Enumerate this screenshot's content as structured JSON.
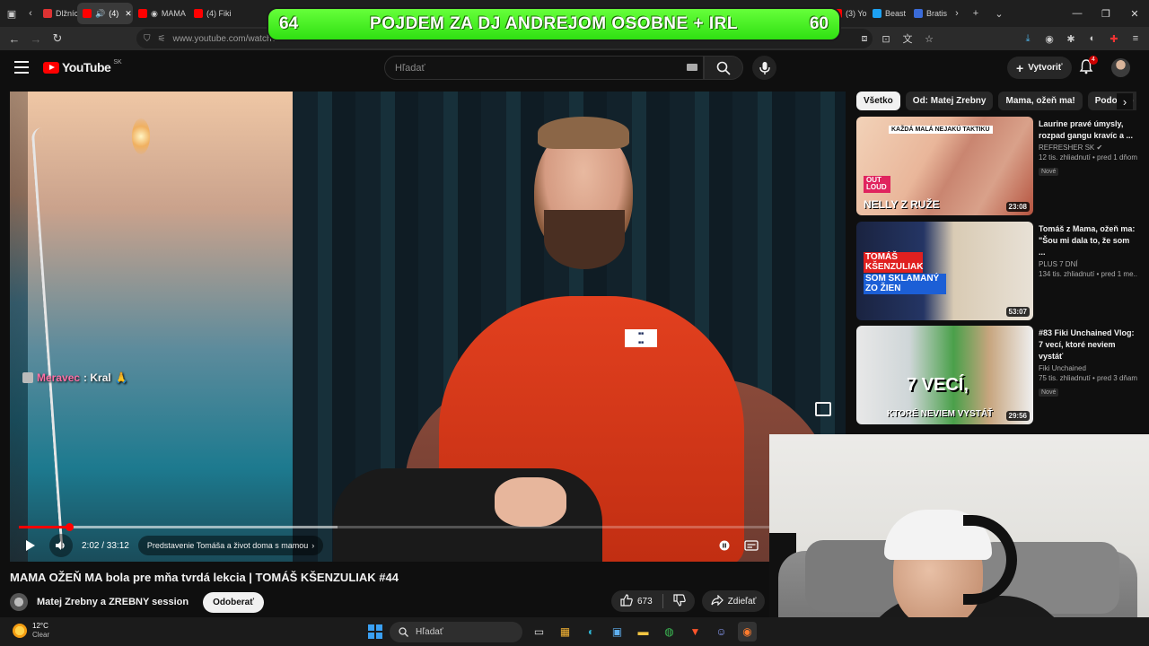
{
  "browser": {
    "tabs": [
      {
        "label": "Dlžníci",
        "active": false,
        "favicon": "doc"
      },
      {
        "label": "(4)",
        "active": true,
        "favicon": "youtube",
        "audio": true
      },
      {
        "label": "MAMA",
        "active": false,
        "favicon": "youtube"
      },
      {
        "label": "(4) Fiki",
        "active": false,
        "favicon": "youtube"
      },
      {
        "label": "(3) Yo",
        "active": false,
        "favicon": "youtube"
      },
      {
        "label": "Beast",
        "active": false,
        "favicon": "other"
      },
      {
        "label": "Bratis",
        "active": false,
        "favicon": "other"
      }
    ],
    "url": "www.youtube.com/watch?"
  },
  "banner": {
    "left_number": "64",
    "text": "POJDEM ZA DJ ANDREJOM OSOBNE + IRL",
    "right_number": "60",
    "color": "#3be81a"
  },
  "masthead": {
    "logo_text": "YouTube",
    "country": "SK",
    "search_placeholder": "Hľadať",
    "create_label": "Vytvoriť",
    "notifications_count": "4"
  },
  "player": {
    "chat_nick": "Meravec",
    "chat_message": ": Kral",
    "time": "2:02 / 33:12",
    "chapter": "Predstavenie Tomáša a život doma s mamou",
    "progress_fraction": 0.061,
    "buffer_fraction": 0.39,
    "accent": "#ff0000"
  },
  "video": {
    "title": "MAMA OŽEŇ MA bola pre mňa tvrdá lekcia | TOMÁŠ KŠENZULIAK #44",
    "channel": "Matej Zrebny a ZREBNY session",
    "subscribe_label": "Odoberať",
    "likes": "673",
    "share_label": "Zdieľať"
  },
  "chips": [
    "Všetko",
    "Od: Matej Zrebny",
    "Mama, ožeň ma!",
    "Podobné"
  ],
  "recommendations": [
    {
      "title": "Laurine pravé úmysly, rozpad gangu kravíc a ...",
      "channel": "REFRESHER SK",
      "views": "12 tis. zhliadnutí • pred 1 dňom",
      "badge": "Nové",
      "duration": "23:08",
      "caption_top": "KAŽDÁ MALÁ NEJAKÚ TAKTIKU",
      "caption_mid": "OUT LOUD",
      "caption": "NELLY Z RUŽE"
    },
    {
      "title": "Tomáš z Mama, ožeň ma: \"Šou mi dala to, že som ...",
      "channel": "PLUS 7 DNÍ",
      "views": "134 tis. zhliadnutí • pred 1 me...",
      "badge": "",
      "duration": "53:07",
      "caption_top": "TOMÁŠ KŠENZULIAK",
      "caption": "SOM SKLAMANÝ ZO ŽIEN"
    },
    {
      "title": "#83 Fiki Unchained Vlog: 7 vecí, ktoré neviem vystáť",
      "channel": "Fiki Unchained",
      "views": "75 tis. zhliadnutí • pred 3 dňami",
      "badge": "Nové",
      "duration": "29:56",
      "caption_top": "7 VECÍ,",
      "caption": "KTORÉ NEVIEM VYSTÁŤ"
    }
  ],
  "taskbar": {
    "temperature": "12°C",
    "condition": "Clear",
    "search_placeholder": "Hľadať"
  }
}
